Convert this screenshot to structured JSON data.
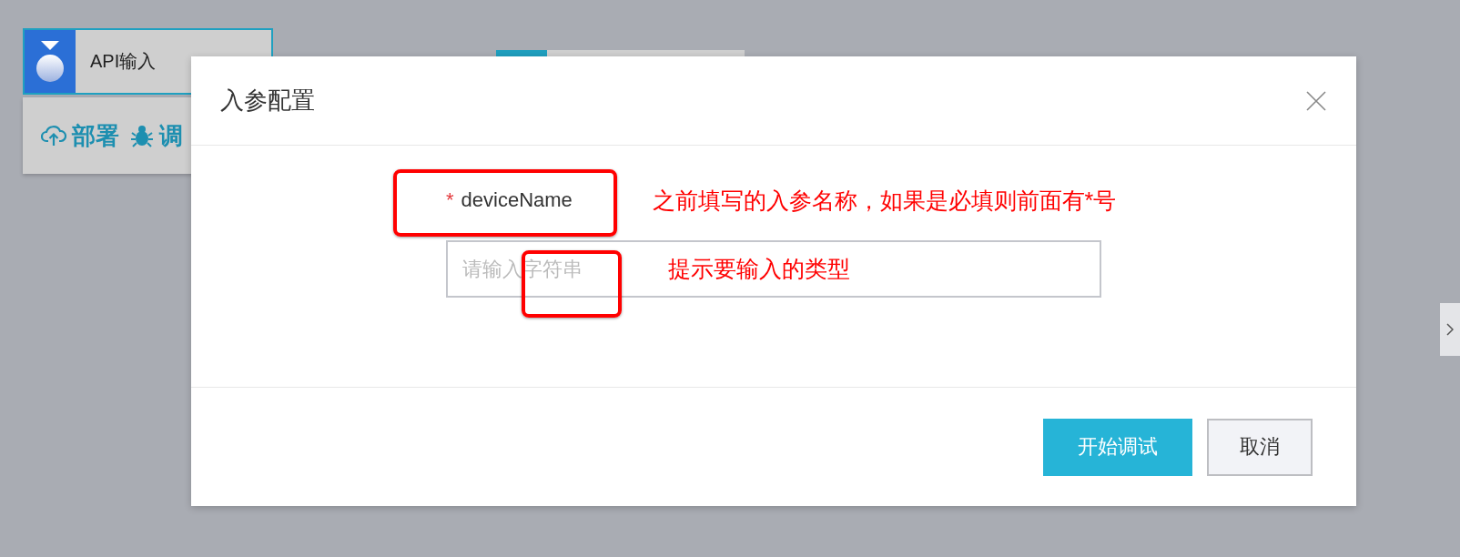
{
  "canvas": {
    "nodes": [
      {
        "kind": "api-input",
        "label": "API输入"
      },
      {
        "kind": "blank"
      }
    ],
    "toolbar": [
      {
        "kind": "deploy",
        "label": "部署"
      },
      {
        "kind": "debug",
        "label": "调"
      }
    ]
  },
  "dialog": {
    "title": "入参配置",
    "fields": [
      {
        "label": "deviceName",
        "required_mark": "*",
        "placeholder": "请输入字符串",
        "label_note": "之前填写的入参名称，如果是必填则前面有*号",
        "placeholder_note": "提示要输入的类型"
      }
    ],
    "buttons": [
      {
        "label": "开始调试",
        "kind": "primary"
      },
      {
        "label": "取消",
        "kind": "default"
      }
    ]
  }
}
